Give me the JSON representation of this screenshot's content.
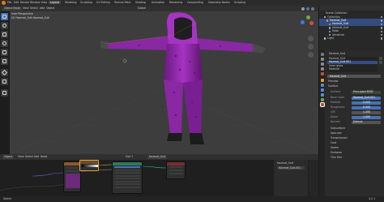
{
  "menus": [
    "File",
    "Edit",
    "Render",
    "Window",
    "Help"
  ],
  "workspaces": [
    {
      "label": "Layout",
      "active": true
    },
    {
      "label": "Modeling",
      "active": false
    },
    {
      "label": "Sculpting",
      "active": false
    },
    {
      "label": "UV Editing",
      "active": false
    },
    {
      "label": "Texture Paint",
      "active": false
    },
    {
      "label": "Shading",
      "active": false
    },
    {
      "label": "Animation",
      "active": false
    },
    {
      "label": "Rendering",
      "active": false
    },
    {
      "label": "Compositing",
      "active": false
    },
    {
      "label": "Geometry Nodes",
      "active": false
    },
    {
      "label": "Scripting",
      "active": false
    }
  ],
  "viewport": {
    "mode": "Object Mode",
    "menus": [
      "View",
      "Select",
      "Add",
      "Object"
    ],
    "overlay_title": "User Perspective",
    "overlay_subtitle": "(0) Hazmat_Suit.Hazmat_Suit",
    "shading_labels": [
      "Global"
    ]
  },
  "outliner": {
    "header": "Scene Collection",
    "rows": [
      {
        "label": "Collection",
        "indent": 1,
        "color": "#cfcfcf",
        "selected": false
      },
      {
        "label": "Hazmat_Suit",
        "indent": 2,
        "color": "#e49a2f",
        "selected": true
      },
      {
        "label": "Hazmat_Suit",
        "indent": 3,
        "color": "#e49a2f",
        "selected": true
      },
      {
        "label": "Hazmat_Suit",
        "indent": 3,
        "color": "#8fb8e8",
        "selected": false
      },
      {
        "label": "Mask",
        "indent": 3,
        "color": "#8fb8e8",
        "selected": false
      },
      {
        "label": "Armature",
        "indent": 3,
        "color": "#8fb8e8",
        "selected": false
      },
      {
        "label": "Light",
        "indent": 1,
        "color": "#cfcfcf",
        "selected": false
      }
    ]
  },
  "properties": {
    "object_name": "Hazmat_Suit",
    "material_slots": [
      "Hazmat_Suit",
      "Hazmat_Suit.001",
      "Inner glass",
      "Material"
    ],
    "material_name": "Hazmat_Suit",
    "sections": [
      "Preview",
      "Surface"
    ],
    "surface_label": "Surface",
    "surface_value": "Principled BSDF",
    "fields": [
      {
        "label": "Base Color",
        "value": "Hazmat_Suit.001",
        "kind": "text"
      },
      {
        "label": "Metallic",
        "value": "0.000",
        "kind": "num"
      },
      {
        "label": "Roughness",
        "value": "0.500",
        "kind": "num"
      },
      {
        "label": "IOR",
        "value": "1.450",
        "kind": "num"
      },
      {
        "label": "Alpha",
        "value": "1.000",
        "kind": "num"
      },
      {
        "label": "Normal",
        "value": "Default",
        "kind": "text"
      }
    ],
    "subsections": [
      "Subsurface",
      "Specular",
      "Transmission",
      "Coat",
      "Sheen",
      "Emission",
      "Thin Film"
    ]
  },
  "node_editor": {
    "mode": "Object",
    "menus": [
      "View",
      "Select",
      "Add",
      "Node"
    ],
    "slot_label": "Slot 1",
    "material_label": "Hazmat_Suit",
    "panel_title": "Hazmat_Suit",
    "panel_sub": "Hazmat_Suit.001"
  },
  "colors": {
    "suit": "#9b2fb5",
    "suit_shadow": "#5e1470",
    "suit_highlight": "#c04adf",
    "accent": "#4772b3",
    "active_ws": "#4a4a4a",
    "node_texture": "#8a5a2c",
    "node_shader": "#2d7a5a",
    "node_output": "#7a2d2d"
  },
  "status": {
    "left": "Select",
    "right": "4.2.1"
  }
}
